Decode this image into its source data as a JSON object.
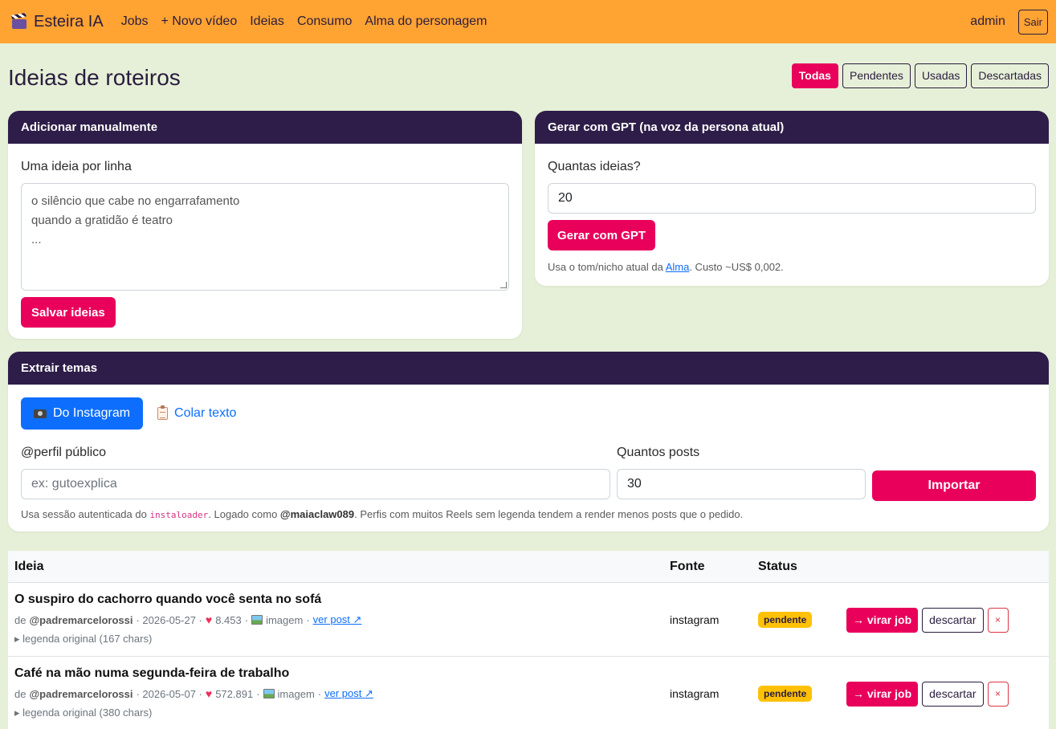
{
  "nav": {
    "brand": "Esteira IA",
    "brand_icon": "clapperboard-icon",
    "links": [
      "Jobs",
      "+ Novo vídeo",
      "Ideias",
      "Consumo",
      "Alma do personagem"
    ],
    "user": "admin",
    "logout": "Sair"
  },
  "page": {
    "title": "Ideias de roteiros",
    "filters": [
      "Todas",
      "Pendentes",
      "Usadas",
      "Descartadas"
    ],
    "active_filter": "Todas"
  },
  "manual": {
    "header": "Adicionar manualmente",
    "label": "Uma ideia por linha",
    "placeholder_lines": [
      "o silêncio que cabe no engarrafamento",
      "quando a gratidão é teatro",
      "..."
    ],
    "save": "Salvar ideias"
  },
  "gpt": {
    "header": "Gerar com GPT (na voz da persona atual)",
    "label": "Quantas ideias?",
    "value": "20",
    "button": "Gerar com GPT",
    "help_pre": "Usa o tom/nicho atual da ",
    "help_link": "Alma",
    "help_post": ". Custo ~US$ 0,002."
  },
  "extract": {
    "header": "Extrair temas",
    "tab_instagram": "Do Instagram",
    "tab_paste": "Colar texto",
    "profile_label": "@perfil público",
    "profile_placeholder": "ex: gutoexplica",
    "posts_label": "Quantos posts",
    "posts_value": "30",
    "import": "Importar",
    "help_pre": "Usa sessão autenticada do ",
    "help_code": "instaloader",
    "help_mid": ". Logado como ",
    "help_user": "@maiaclaw089",
    "help_post": ". Perfis com muitos Reels sem legenda tendem a render menos posts que o pedido."
  },
  "table": {
    "headers": [
      "Ideia",
      "Fonte",
      "Status"
    ],
    "rows": [
      {
        "title": "O suspiro do cachorro quando você senta no sofá",
        "by": "de",
        "author": "@padremarcelorossi",
        "date": "· 2026-05-27 ·",
        "likes": "8.453",
        "media": "imagem",
        "link": "ver post ↗",
        "details": "legenda original (167 chars)",
        "source": "instagram",
        "status": "pendente",
        "job": "→ virar job",
        "discard": "descartar",
        "delete": "×"
      },
      {
        "title": "Café na mão numa segunda-feira de trabalho",
        "by": "de",
        "author": "@padremarcelorossi",
        "date": "· 2026-05-07 ·",
        "likes": "572.891",
        "media": "imagem",
        "link": "ver post ↗",
        "details": "legenda original (380 chars)",
        "source": "instagram",
        "status": "pendente",
        "job": "→ virar job",
        "discard": "descartar",
        "delete": "×"
      }
    ]
  },
  "colors": {
    "navbar": "#ffa332",
    "card_header": "#2d1d48",
    "accent": "#e8005b",
    "primary": "#0d6efd",
    "badge": "#ffc107"
  }
}
